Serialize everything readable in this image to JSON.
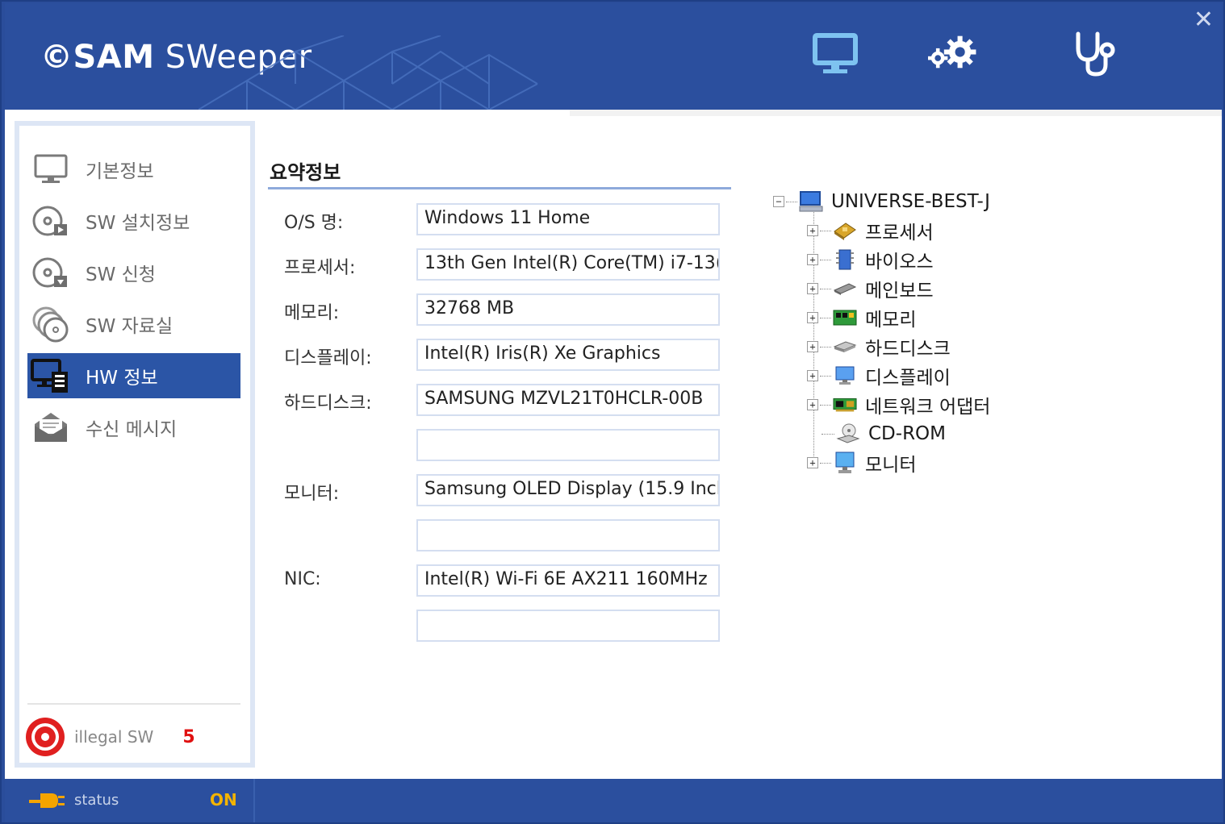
{
  "app": {
    "logo_prefix": "©SAM",
    "logo_suffix": " SWeeper",
    "close_symbol": "✕"
  },
  "header_icons": [
    "monitor-icon",
    "settings-gears-icon",
    "stethoscope-icon"
  ],
  "sidebar": {
    "items": [
      {
        "label": "기본정보",
        "icon": "monitor-icon"
      },
      {
        "label": "SW 설치정보",
        "icon": "disc-install-icon"
      },
      {
        "label": "SW 신청",
        "icon": "disc-download-icon"
      },
      {
        "label": "SW 자료실",
        "icon": "disc-stack-icon"
      },
      {
        "label": "HW 정보",
        "icon": "hardware-icon"
      },
      {
        "label": "수신 메시지",
        "icon": "envelope-icon"
      }
    ],
    "active_index": 4,
    "illegal": {
      "label": "illegal  SW",
      "count": "5"
    }
  },
  "summary": {
    "title": "요약정보",
    "fields": [
      {
        "label": "O/S 명:",
        "value": "Windows 11 Home"
      },
      {
        "label": "프로세서:",
        "value": "13th Gen Intel(R) Core(TM) i7-13("
      },
      {
        "label": "메모리:",
        "value": "32768 MB"
      },
      {
        "label": "디스플레이:",
        "value": "Intel(R) Iris(R) Xe Graphics"
      },
      {
        "label": "하드디스크:",
        "value": "SAMSUNG MZVL21T0HCLR-00B"
      },
      {
        "label": "",
        "value": ""
      },
      {
        "label": "모니터:",
        "value": "Samsung OLED Display (15.9 Incl"
      },
      {
        "label": "",
        "value": ""
      },
      {
        "label": "NIC:",
        "value": "Intel(R) Wi-Fi 6E AX211 160MHz"
      },
      {
        "label": "",
        "value": ""
      }
    ]
  },
  "tree": {
    "root": "UNIVERSE-BEST-J",
    "nodes": [
      {
        "label": "프로세서",
        "icon": "processor-icon",
        "expandable": true
      },
      {
        "label": "바이오스",
        "icon": "bios-chip-icon",
        "expandable": true
      },
      {
        "label": "메인보드",
        "icon": "mainboard-icon",
        "expandable": true
      },
      {
        "label": "메모리",
        "icon": "memory-card-icon",
        "expandable": true
      },
      {
        "label": "하드디스크",
        "icon": "harddisk-icon",
        "expandable": true
      },
      {
        "label": "디스플레이",
        "icon": "display-icon",
        "expandable": true
      },
      {
        "label": "네트워크 어댑터",
        "icon": "network-adapter-icon",
        "expandable": true
      },
      {
        "label": "CD-ROM",
        "icon": "cdrom-icon",
        "expandable": false
      },
      {
        "label": "모니터",
        "icon": "monitor-icon",
        "expandable": true
      }
    ]
  },
  "status": {
    "label": "status",
    "value": "ON"
  },
  "colors": {
    "brand_blue": "#2b4f9e",
    "active_nav": "#2b55a6",
    "status_on": "#f4b400",
    "illegal_count": "#e01010"
  }
}
